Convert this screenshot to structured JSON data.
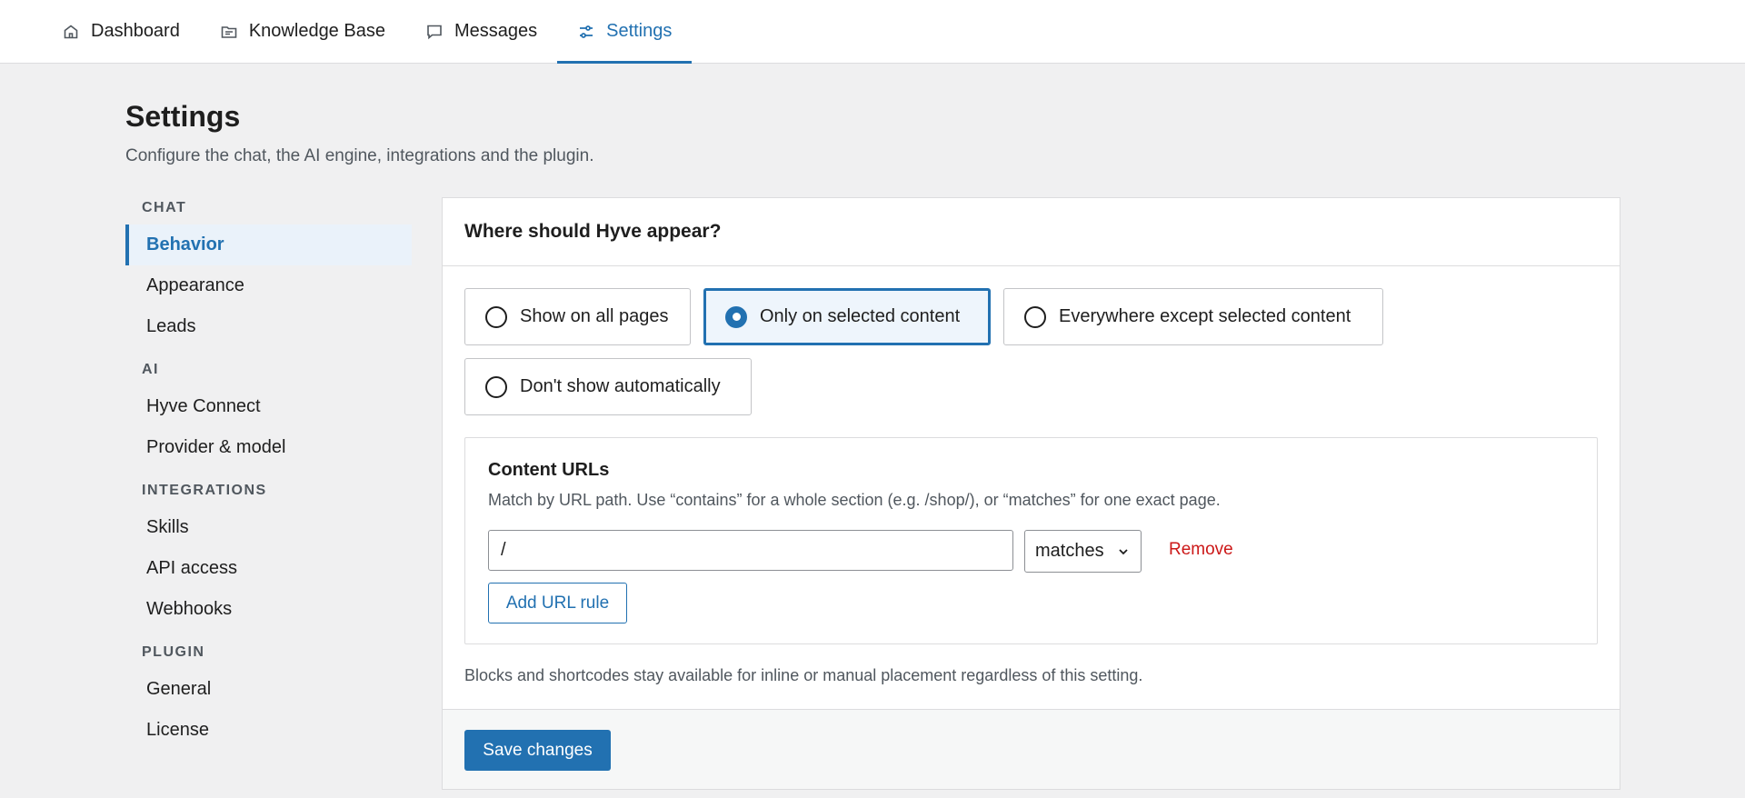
{
  "nav": {
    "tabs": [
      {
        "label": "Dashboard",
        "icon": "home-icon"
      },
      {
        "label": "Knowledge Base",
        "icon": "folder-icon"
      },
      {
        "label": "Messages",
        "icon": "chat-bubble-icon"
      },
      {
        "label": "Settings",
        "icon": "sliders-icon",
        "active": true
      }
    ]
  },
  "header": {
    "title": "Settings",
    "subtitle": "Configure the chat, the AI engine, integrations and the plugin."
  },
  "sidebar": {
    "groups": [
      {
        "label": "CHAT",
        "items": [
          "Behavior",
          "Appearance",
          "Leads"
        ]
      },
      {
        "label": "AI",
        "items": [
          "Hyve Connect",
          "Provider & model"
        ]
      },
      {
        "label": "INTEGRATIONS",
        "items": [
          "Skills",
          "API access",
          "Webhooks"
        ]
      },
      {
        "label": "PLUGIN",
        "items": [
          "General",
          "License"
        ]
      }
    ],
    "active_item": "Behavior"
  },
  "card": {
    "title": "Where should Hyve appear?",
    "options": [
      {
        "label": "Show on all pages",
        "selected": false
      },
      {
        "label": "Only on selected content",
        "selected": true
      },
      {
        "label": "Everywhere except selected content",
        "selected": false
      },
      {
        "label": "Don't show automatically",
        "selected": false
      }
    ],
    "content_urls": {
      "title": "Content URLs",
      "help": "Match by URL path. Use “contains” for a whole section (e.g. /shop/), or “matches” for one exact page.",
      "rule_value": "/",
      "match_type": "matches",
      "remove_label": "Remove",
      "add_rule_label": "Add URL rule"
    },
    "footnote": "Blocks and shortcodes stay available for inline or manual placement regardless of this setting.",
    "save_label": "Save changes"
  },
  "colors": {
    "accent": "#2271b1",
    "danger": "#cc1818",
    "background": "#f0f0f1"
  }
}
